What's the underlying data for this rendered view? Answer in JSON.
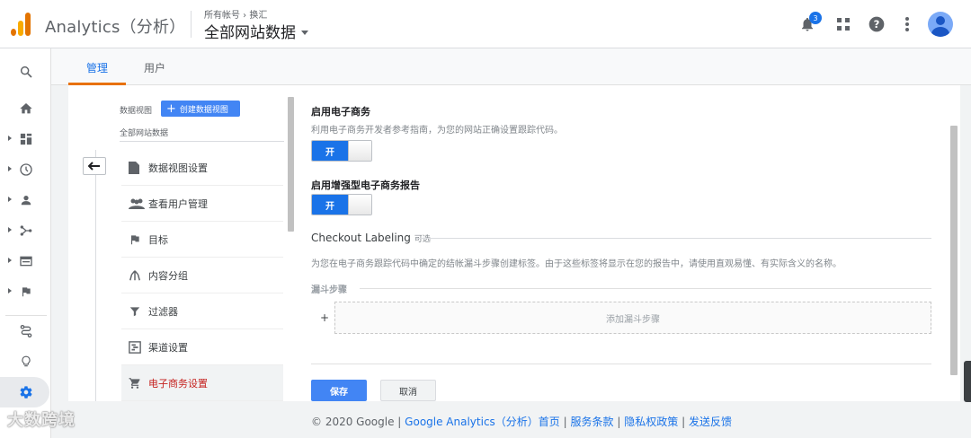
{
  "header": {
    "app_title": "Analytics（分析）",
    "breadcrumb": "所有帐号 › 换汇",
    "view_name": "全部网站数据",
    "notification_count": "3",
    "icons": [
      "bell-icon",
      "apps-grid-icon",
      "help-icon",
      "more-vert-icon",
      "avatar"
    ]
  },
  "leftnav": {
    "items": [
      "search-icon",
      "home-icon",
      "dashboard-icon",
      "clock-icon",
      "person-icon",
      "acquisition-icon",
      "behavior-icon",
      "flag-icon",
      "attribution-icon",
      "lightbulb-icon",
      "settings-icon"
    ]
  },
  "tabs": [
    {
      "label": "管理"
    },
    {
      "label": "用户"
    }
  ],
  "admin_column": {
    "label": "数据视图",
    "create_button": "创建数据视图",
    "view_name": "全部网站数据",
    "menu": [
      {
        "label": "数据视图设置",
        "icon": "document-icon"
      },
      {
        "label": "查看用户管理",
        "icon": "people-icon"
      },
      {
        "label": "目标",
        "icon": "flag-icon"
      },
      {
        "label": "内容分组",
        "icon": "content-grouping-icon"
      },
      {
        "label": "过滤器",
        "icon": "filter-icon"
      },
      {
        "label": "渠道设置",
        "icon": "channel-icon"
      },
      {
        "label": "电子商务设置",
        "icon": "cart-icon"
      }
    ]
  },
  "main": {
    "ecommerce_title": "启用电子商务",
    "ecommerce_desc": "利用电子商务开发者参考指南，为您的网站正确设置跟踪代码。",
    "ecommerce_toggle": "开",
    "enhanced_title": "启用增强型电子商务报告",
    "enhanced_toggle": "开",
    "checkout_title": "Checkout Labeling",
    "checkout_optional": "可选",
    "checkout_desc": "为您在电子商务跟踪代码中确定的结帐漏斗步骤创建标签。由于这些标签将显示在您的报告中，请使用直观易懂、有实际含义的名称。",
    "funnel_title": "漏斗步骤",
    "funnel_plus": "+",
    "funnel_add": "添加漏斗步骤",
    "save": "保存",
    "cancel": "取消"
  },
  "footer": {
    "copyright": "© 2020 Google |",
    "link_ga": "Google Analytics（分析）首页",
    "sep1": "|",
    "link_terms": "服务条款",
    "sep2": "|",
    "link_privacy": "隐私权政策",
    "sep3": "|",
    "link_feedback": "发送反馈"
  },
  "watermark": "大数跨境",
  "colors": {
    "accent": "#1a73e8",
    "tab_underline": "#e8710a",
    "active_menu": "#c5221f",
    "button_blue": "#4285f4"
  }
}
